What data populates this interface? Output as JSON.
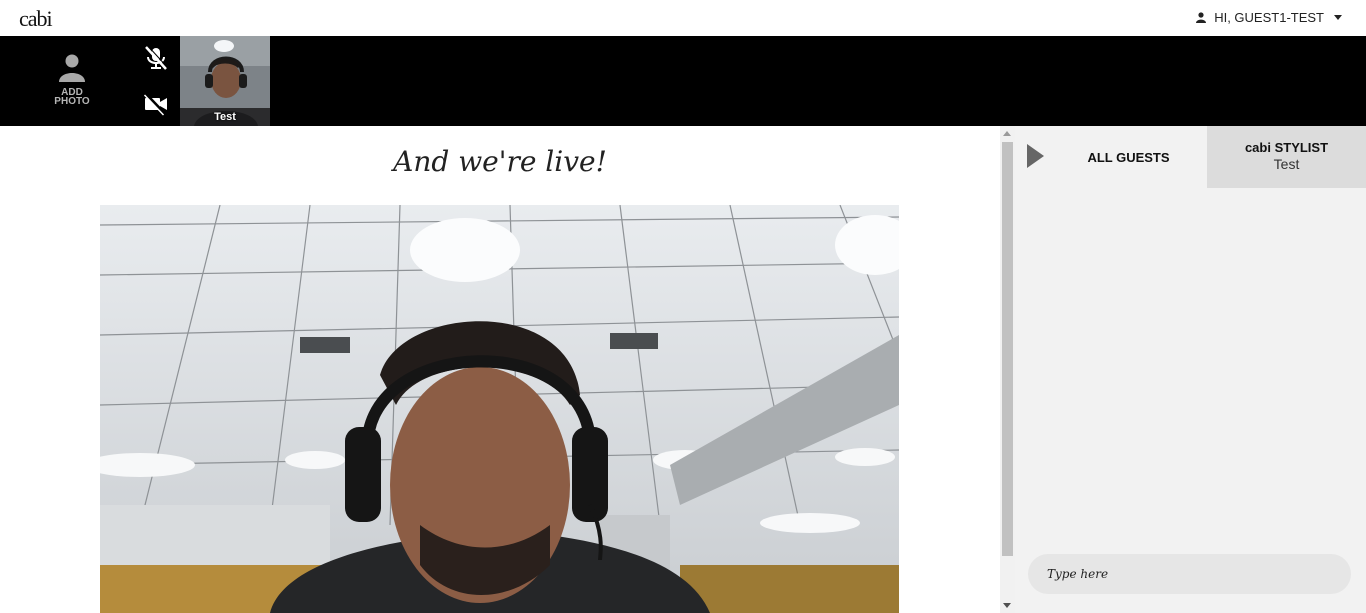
{
  "brand": {
    "logo_text": "cabi"
  },
  "header": {
    "user_greeting": "HI, GUEST1-TEST",
    "user_icon": "user-icon",
    "caret_icon": "caret-down-icon"
  },
  "video_bar": {
    "add_photo_line1": "ADD",
    "add_photo_line2": "PHOTO",
    "mic_icon": "mic-muted-icon",
    "camera_icon": "camera-off-icon",
    "participant_name": "Test"
  },
  "main": {
    "headline": "And we're live!"
  },
  "chat": {
    "tab_all_guests": "ALL GUESTS",
    "tab_stylist_title": "cabi STYLIST",
    "tab_stylist_name": "Test",
    "input_placeholder": "Type here",
    "collapse_icon": "play-icon"
  },
  "colors": {
    "video_bar_bg": "#000000",
    "chat_bg": "#f2f2f2",
    "stylist_tab_bg": "#dcdcdc"
  }
}
